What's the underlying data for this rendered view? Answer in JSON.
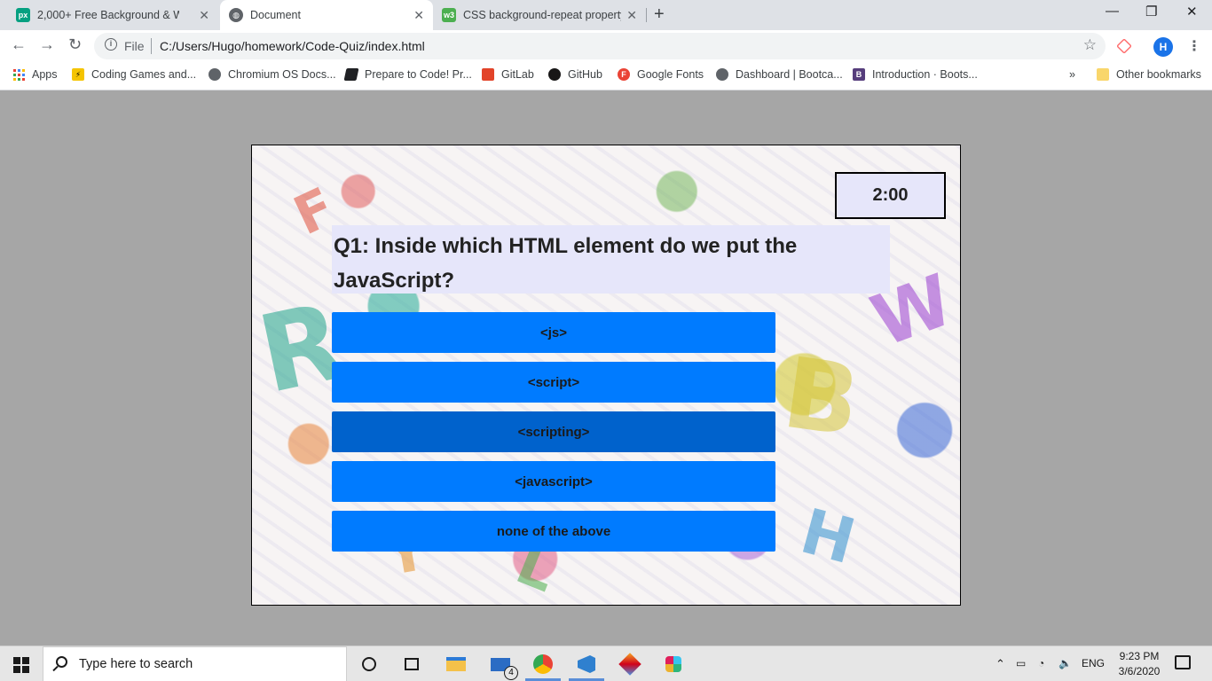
{
  "browser": {
    "tabs": [
      {
        "title": "2,000+ Free Background & Wate",
        "favicon": "pexels-icon"
      },
      {
        "title": "Document",
        "favicon": "globe-icon"
      },
      {
        "title": "CSS background-repeat property",
        "favicon": "w3schools-icon"
      }
    ],
    "address": {
      "scheme_label": "File",
      "url": "C:/Users/Hugo/homework/Code-Quiz/index.html"
    },
    "profile_initial": "H",
    "bookmarks": [
      {
        "label": "Apps"
      },
      {
        "label": "Coding Games and..."
      },
      {
        "label": "Chromium OS Docs..."
      },
      {
        "label": "Prepare to Code! Pr..."
      },
      {
        "label": "GitLab"
      },
      {
        "label": "GitHub"
      },
      {
        "label": "Google Fonts"
      },
      {
        "label": "Dashboard | Bootca..."
      },
      {
        "label": "Introduction · Boots..."
      }
    ],
    "other_bookmarks": "Other bookmarks",
    "overflow": "»"
  },
  "quiz": {
    "timer": "2:00",
    "question": "Q1: Inside which HTML element do we put the JavaScript?",
    "choices": [
      "<js>",
      "<script>",
      "<scripting>",
      "<javascript>",
      "none of the above"
    ]
  },
  "taskbar": {
    "search_placeholder": "Type here to search",
    "mail_badge": "4",
    "language": "ENG",
    "time": "9:23 PM",
    "date": "3/6/2020"
  },
  "colors": {
    "choice_button": "#007bff",
    "choice_button_hover": "#0062cc",
    "panel": "#e6e6fa",
    "page_background": "#a6a6a6"
  }
}
